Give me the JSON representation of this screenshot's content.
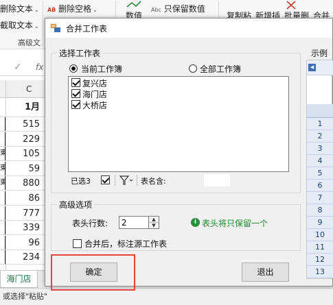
{
  "ribbon": {
    "delete_text_label": "删除文本",
    "extract_text_label": "截取文本",
    "delete_spaces_label": "删除空格",
    "value_label": "数值",
    "keep_values_label": "只保留数值",
    "abc_label": "Abc",
    "ab_label": "AB",
    "copy_paste_label": "复制粘",
    "new_add_label": "新增插",
    "batch_delete_label": "批量删",
    "merge_label": "合并",
    "group_label": "高级文"
  },
  "formula_bar": {
    "cancel_symbol": "✓",
    "fx_label": "fx"
  },
  "sheet": {
    "column_header": "C",
    "header_cell": "1月",
    "values": [
      "515",
      "229",
      "105",
      "59",
      "880",
      "86",
      "777",
      "339",
      "96",
      "234"
    ],
    "left_fragments": [
      "",
      "",
      "東",
      "東",
      "東",
      "",
      "",
      "",
      "",
      ""
    ],
    "active_tab": "海门店"
  },
  "status_bar": {
    "text": "或选择\"粘贴\""
  },
  "dialog": {
    "title": "合并工作表",
    "select_group_label": "选择工作表",
    "radio_current": "当前工作簿",
    "radio_all": "全部工作簿",
    "radio_current_checked": true,
    "sheets": [
      {
        "name": "复兴店",
        "checked": true
      },
      {
        "name": "海门店",
        "checked": true
      },
      {
        "name": "大桥店",
        "checked": true
      }
    ],
    "selected_count_label": "已选3",
    "name_contains_label": "表名含:",
    "advanced_group_label": "高级选项",
    "header_rows_label": "表头行数:",
    "header_rows_value": "2",
    "info_text": "表头将只保留一个",
    "annotate_source_label": "合并后，标注源工作表",
    "ok_label": "确定",
    "exit_label": "退出",
    "example_label": "示例",
    "example_rows": [
      "1",
      "2",
      "3",
      "4",
      "5",
      "6",
      "7",
      "8",
      "9",
      "10",
      "11",
      "12",
      "13"
    ]
  },
  "colors": {
    "highlight": "#e8403a",
    "info_green": "#1f8a2e",
    "tab_green": "#217346"
  }
}
